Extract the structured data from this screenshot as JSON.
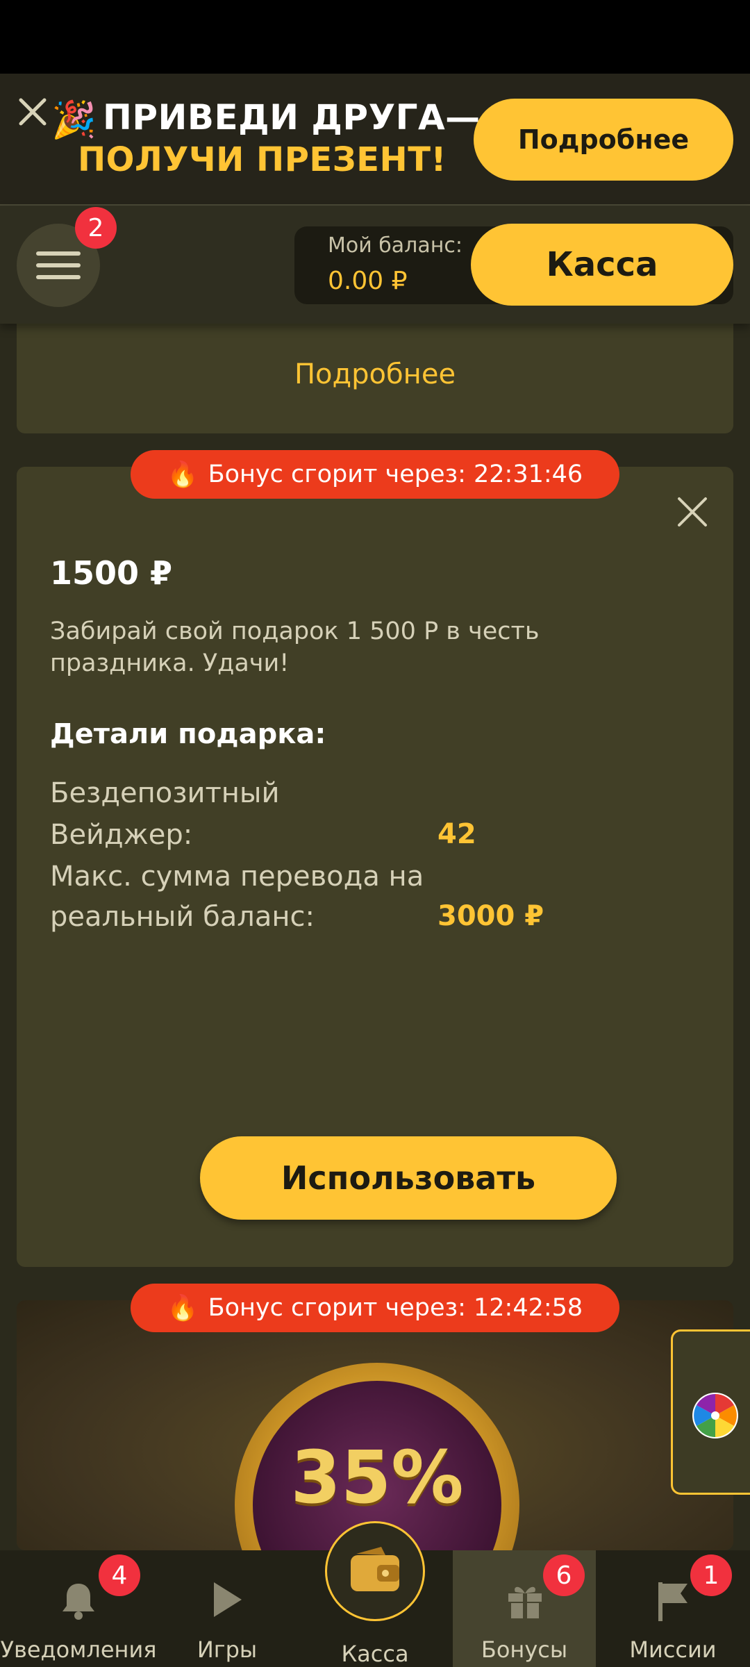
{
  "promo": {
    "emoji": "🎉",
    "line1": "ПРИВЕДИ ДРУГА—",
    "line2": "ПОЛУЧИ ПРЕЗЕНТ!",
    "button": "Подробнее"
  },
  "header": {
    "menu_badge": "2",
    "balance_label": "Мой баланс:",
    "balance_value": "0.00 ₽",
    "kassa_button": "Касса"
  },
  "card_top": {
    "link": "Подробнее"
  },
  "bonus_card": {
    "timer": "Бонус сгорит через: 22:31:46",
    "amount": "1500 ₽",
    "description": "Забирай свой подарок 1 500 Р в честь праздника. Удачи!",
    "details_title": "Детали подарка:",
    "row1_label": "Бездепозитный",
    "row2_label": "Вейджер:",
    "row2_value": "42",
    "row3_label_a": "Макс. сумма перевода на",
    "row3_label_b": "реальный баланс:",
    "row3_value": "3000 ₽",
    "use_button": "Использовать"
  },
  "bonus_card2": {
    "timer": "Бонус сгорит через: 12:42:58",
    "percent": "35%"
  },
  "bottom_nav": [
    {
      "label": "Уведомления",
      "icon": "bell-icon",
      "badge": "4"
    },
    {
      "label": "Игры",
      "icon": "play-icon"
    },
    {
      "label": "Касса",
      "icon": "wallet-icon"
    },
    {
      "label": "Бонусы",
      "icon": "gift-icon",
      "badge": "6",
      "active": true
    },
    {
      "label": "Миссии",
      "icon": "flag-icon",
      "badge": "1"
    }
  ],
  "colors": {
    "accent": "#ffc434",
    "timer": "#ec3b1c",
    "badge": "#f1313e",
    "card": "#413f26"
  }
}
